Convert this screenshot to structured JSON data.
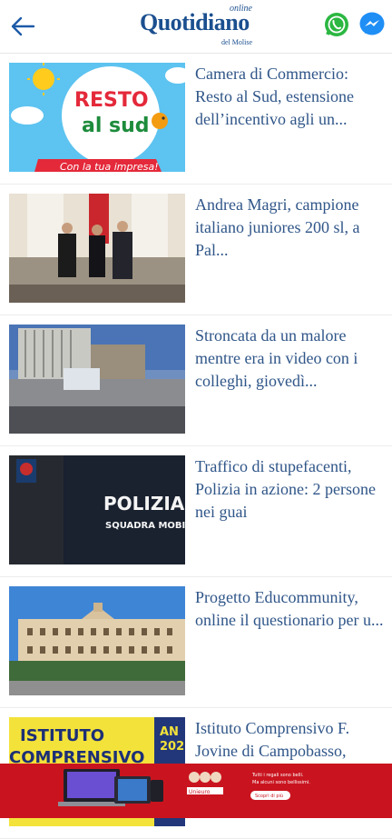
{
  "header": {
    "logo_online": "online",
    "logo_main": "Quotidiano",
    "logo_sub": "del Molise",
    "back_icon": "back-arrow-icon",
    "share_icons": [
      "whatsapp-icon",
      "messenger-icon"
    ]
  },
  "articles": [
    {
      "title": "Camera di Commercio: Resto al Sud, estensione dell’incentivo agli un...",
      "image_text": [
        "RESTO",
        "al sud",
        "Con la tua impresa!"
      ]
    },
    {
      "title": "Andrea Magri, campione italiano juniores 200 sl, a Pal..."
    },
    {
      "title": "Stroncata da un malore mentre era in video con i colleghi, giovedì..."
    },
    {
      "title": "Traffico di stupefacenti, Polizia in azione: 2 persone nei guai",
      "image_text": [
        "POLIZIA",
        "SQUADRA MOBILE"
      ]
    },
    {
      "title": "Progetto Educommunity, online il questionario per u..."
    },
    {
      "title": "Istituto Comprensivo F. Jovine di Campobasso,",
      "image_text": [
        "ISTITUTO",
        "COMPRENSIVO",
        "AN",
        "202"
      ]
    }
  ],
  "ad": {
    "text_line1": "Tutti i regali sono belli.",
    "text_line2": "Ma alcuni sono bellissimi.",
    "button": "Scopri di più",
    "brand": "Unieuro"
  },
  "colors": {
    "title": "#2f5588",
    "ad_bg": "#c9141f",
    "logo": "#1b4f8f"
  }
}
